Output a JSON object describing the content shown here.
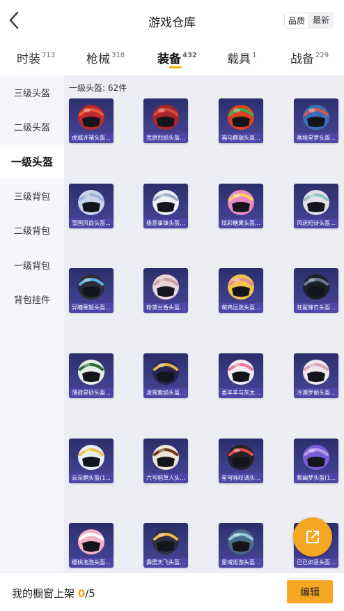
{
  "header": {
    "title": "游戏仓库",
    "sort_quality": "品质",
    "sort_latest": "最新"
  },
  "tabs": [
    {
      "label": "时装",
      "count": "713"
    },
    {
      "label": "枪械",
      "count": "318"
    },
    {
      "label": "装备",
      "count": "432"
    },
    {
      "label": "载具",
      "count": "1"
    },
    {
      "label": "战备",
      "count": "229"
    }
  ],
  "sidebar": {
    "items": [
      "三级头盔",
      "二级头盔",
      "一级头盔",
      "三级背包",
      "二级背包",
      "一级背包",
      "背包挂件"
    ]
  },
  "section": {
    "title": "一级头盔: 62件"
  },
  "items": [
    {
      "label": "虎威许褚头盔...",
      "color": "#c0282b",
      "accent": "#e85a3c"
    },
    {
      "label": "荒原烈焰头盔...",
      "color": "#a8262a",
      "accent": "#d24a34"
    },
    {
      "label": "福马麒瑞头盔...",
      "color": "#d64520",
      "accent": "#44a855"
    },
    {
      "label": "画境星梦头盔...",
      "color": "#3a6fb8",
      "accent": "#d8554a"
    },
    {
      "label": "雪国风尚头盔...",
      "color": "#c8d4e8",
      "accent": "#9bb2d6"
    },
    {
      "label": "极意事锋头盔...",
      "color": "#eef0f6",
      "accent": "#9aa8c8"
    },
    {
      "label": "炫彩糖果头盔...",
      "color": "#e88ac4",
      "accent": "#f4d25a"
    },
    {
      "label": "风送短诗头盔...",
      "color": "#e6dfe8",
      "accent": "#8dc4c2"
    },
    {
      "label": "异瞳寒姬头盔...",
      "color": "#2a2c36",
      "accent": "#5cb0e8"
    },
    {
      "label": "粉黛兰香头盔...",
      "color": "#e9d6d8",
      "accent": "#c89ea4"
    },
    {
      "label": "萌鸡逗迷头盔...",
      "color": "#f0c44a",
      "accent": "#e88a9a"
    },
    {
      "label": "狂鲨锋刃头盔...",
      "color": "#1e2028",
      "accent": "#6a7a92"
    },
    {
      "label": "薄荷星砂头盔...",
      "color": "#e6efe6",
      "accent": "#2d6a3c"
    },
    {
      "label": "凌霄紫焰头盔...",
      "color": "#2a2450",
      "accent": "#e0b44a"
    },
    {
      "label": "喜羊羊与灰太...",
      "color": "#f4ecf0",
      "accent": "#e47aa0"
    },
    {
      "label": "冷漠罗丽头盔...",
      "color": "#f0e8ec",
      "accent": "#d8a8b6"
    },
    {
      "label": "云朵鹦头盔(1...",
      "color": "#e6f0f8",
      "accent": "#f0c24a"
    },
    {
      "label": "六号稻草人头...",
      "color": "#f0e6d8",
      "accent": "#6a3a1e"
    },
    {
      "label": "星穹咏叹调头...",
      "color": "#26202a",
      "accent": "#e04a4a"
    },
    {
      "label": "紫幽梦头盔(1...",
      "color": "#7a5cd8",
      "accent": "#b69aec"
    },
    {
      "label": "樱桃泡泡头盔...",
      "color": "#f4b2c8",
      "accent": "#ffffff"
    },
    {
      "label": "霹雳天飞头盔...",
      "color": "#2c2e44",
      "accent": "#f0b84a"
    },
    {
      "label": "星域巡游头盔...",
      "color": "#4a6a88",
      "accent": "#9ac8e0"
    },
    {
      "label": "已已如意头盔...",
      "color": "#f0e0b4",
      "accent": "#c8903a"
    }
  ],
  "footer": {
    "label": "我的橱窗上架",
    "count": "0",
    "total": "/5",
    "edit_label": "编辑"
  }
}
